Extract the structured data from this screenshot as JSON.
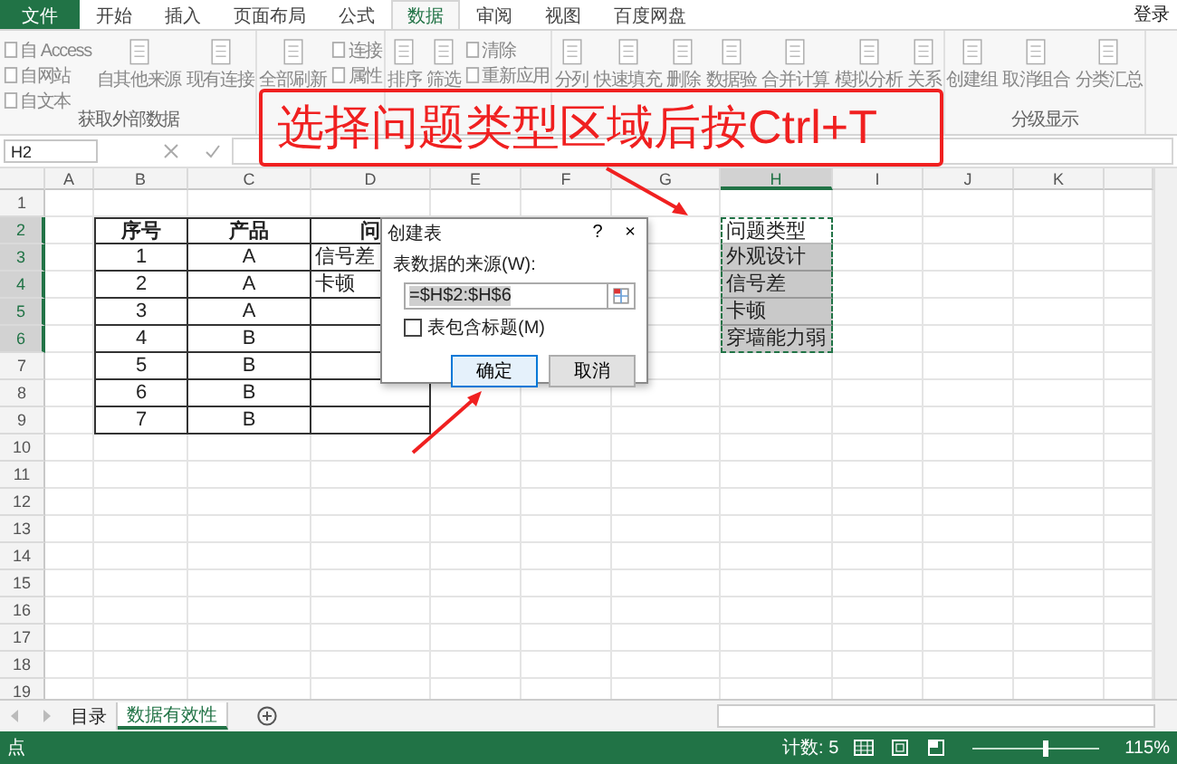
{
  "ribbon_tabs": [
    {
      "label": "文件",
      "kind": "file",
      "selected": false
    },
    {
      "label": "开始",
      "kind": "tab",
      "selected": false
    },
    {
      "label": "插入",
      "kind": "tab",
      "selected": false
    },
    {
      "label": "页面布局",
      "kind": "tab",
      "selected": false
    },
    {
      "label": "公式",
      "kind": "tab",
      "selected": false
    },
    {
      "label": "数据",
      "kind": "tab",
      "selected": true
    },
    {
      "label": "审阅",
      "kind": "tab",
      "selected": false
    },
    {
      "label": "视图",
      "kind": "tab",
      "selected": false
    },
    {
      "label": "百度网盘",
      "kind": "tab",
      "selected": false
    }
  ],
  "account": "登录",
  "ribbon_groups": [
    {
      "label": "获取外部数据",
      "items": [
        {
          "kind": "small",
          "labels": [
            "自 Access",
            "自网站",
            "自文本"
          ]
        },
        {
          "kind": "large",
          "label": "自其他来源"
        },
        {
          "kind": "large",
          "label": "现有连接"
        }
      ]
    },
    {
      "items": [
        {
          "kind": "large",
          "label": "全部刷新"
        },
        {
          "kind": "small",
          "labels": [
            "连接",
            "属性"
          ]
        }
      ]
    },
    {
      "items": [
        {
          "kind": "large",
          "label": "排序"
        },
        {
          "kind": "large",
          "label": "筛选"
        },
        {
          "kind": "small",
          "labels": [
            "清除",
            "重新应用"
          ]
        }
      ]
    },
    {
      "items": [
        {
          "kind": "large",
          "label": "分列"
        },
        {
          "kind": "large",
          "label": "快速填充"
        },
        {
          "kind": "large",
          "label": "删除"
        },
        {
          "kind": "large",
          "label": "数据验"
        },
        {
          "kind": "large",
          "label": "合并计算"
        },
        {
          "kind": "large",
          "label": "模拟分析"
        },
        {
          "kind": "large",
          "label": "关系"
        }
      ]
    },
    {
      "label": "分级显示",
      "items": [
        {
          "kind": "large",
          "label": "创建组"
        },
        {
          "kind": "large",
          "label": "取消组合"
        },
        {
          "kind": "large",
          "label": "分类汇总"
        }
      ]
    }
  ],
  "formula_bar": {
    "name_box": "H2"
  },
  "sheet": {
    "columns": [
      {
        "label": "A",
        "selected": false
      },
      {
        "label": "B",
        "selected": false
      },
      {
        "label": "C",
        "selected": false
      },
      {
        "label": "D",
        "selected": false
      },
      {
        "label": "E",
        "selected": false
      },
      {
        "label": "F",
        "selected": false
      },
      {
        "label": "G",
        "selected": false
      },
      {
        "label": "H",
        "selected": true
      },
      {
        "label": "I",
        "selected": false
      },
      {
        "label": "J",
        "selected": false
      },
      {
        "label": "K",
        "selected": false
      }
    ],
    "rows": [
      {
        "label": "1",
        "selected": false
      },
      {
        "label": "2",
        "selected": true
      },
      {
        "label": "3",
        "selected": true
      },
      {
        "label": "4",
        "selected": true
      },
      {
        "label": "5",
        "selected": true
      },
      {
        "label": "6",
        "selected": true
      },
      {
        "label": "7",
        "selected": false
      },
      {
        "label": "8",
        "selected": false
      },
      {
        "label": "9",
        "selected": false
      },
      {
        "label": "10",
        "selected": false
      },
      {
        "label": "11",
        "selected": false
      },
      {
        "label": "12",
        "selected": false
      },
      {
        "label": "13",
        "selected": false
      },
      {
        "label": "14",
        "selected": false
      },
      {
        "label": "15",
        "selected": false
      },
      {
        "label": "16",
        "selected": false
      },
      {
        "label": "17",
        "selected": false
      },
      {
        "label": "18",
        "selected": false
      },
      {
        "label": "19",
        "selected": false
      }
    ],
    "data_table": {
      "header": [
        "序号",
        "产品",
        "问"
      ],
      "rows": [
        [
          "1",
          "A",
          "信号差"
        ],
        [
          "2",
          "A",
          "卡顿"
        ],
        [
          "3",
          "A"
        ],
        [
          "4",
          "B"
        ],
        [
          "5",
          "B"
        ],
        [
          "6",
          "B"
        ],
        [
          "7",
          "B"
        ]
      ]
    },
    "list_range": {
      "header": "问题类型",
      "items": [
        "外观设计",
        "信号差",
        "卡顿",
        "穿墙能力弱"
      ]
    }
  },
  "dialog": {
    "title": "创建表",
    "help": "?",
    "close": "×",
    "source_label": "表数据的来源(W):",
    "source_value": "=$H$2:$H$6",
    "header_checkbox": {
      "label": "表包含标题(M)",
      "checked": false
    },
    "buttons": [
      {
        "label": "确定",
        "kind": "default"
      },
      {
        "label": "取消",
        "kind": "normal"
      }
    ]
  },
  "annotation": {
    "text": "选择问题类型区域后按Ctrl+T"
  },
  "sheet_tabs": [
    {
      "label": "目录",
      "selected": false
    },
    {
      "label": "数据有效性",
      "selected": true
    }
  ],
  "status_bar": {
    "mode": "点",
    "count": "计数: 5",
    "zoom_slider": {
      "level": 0.55
    },
    "zoom": "115%"
  }
}
